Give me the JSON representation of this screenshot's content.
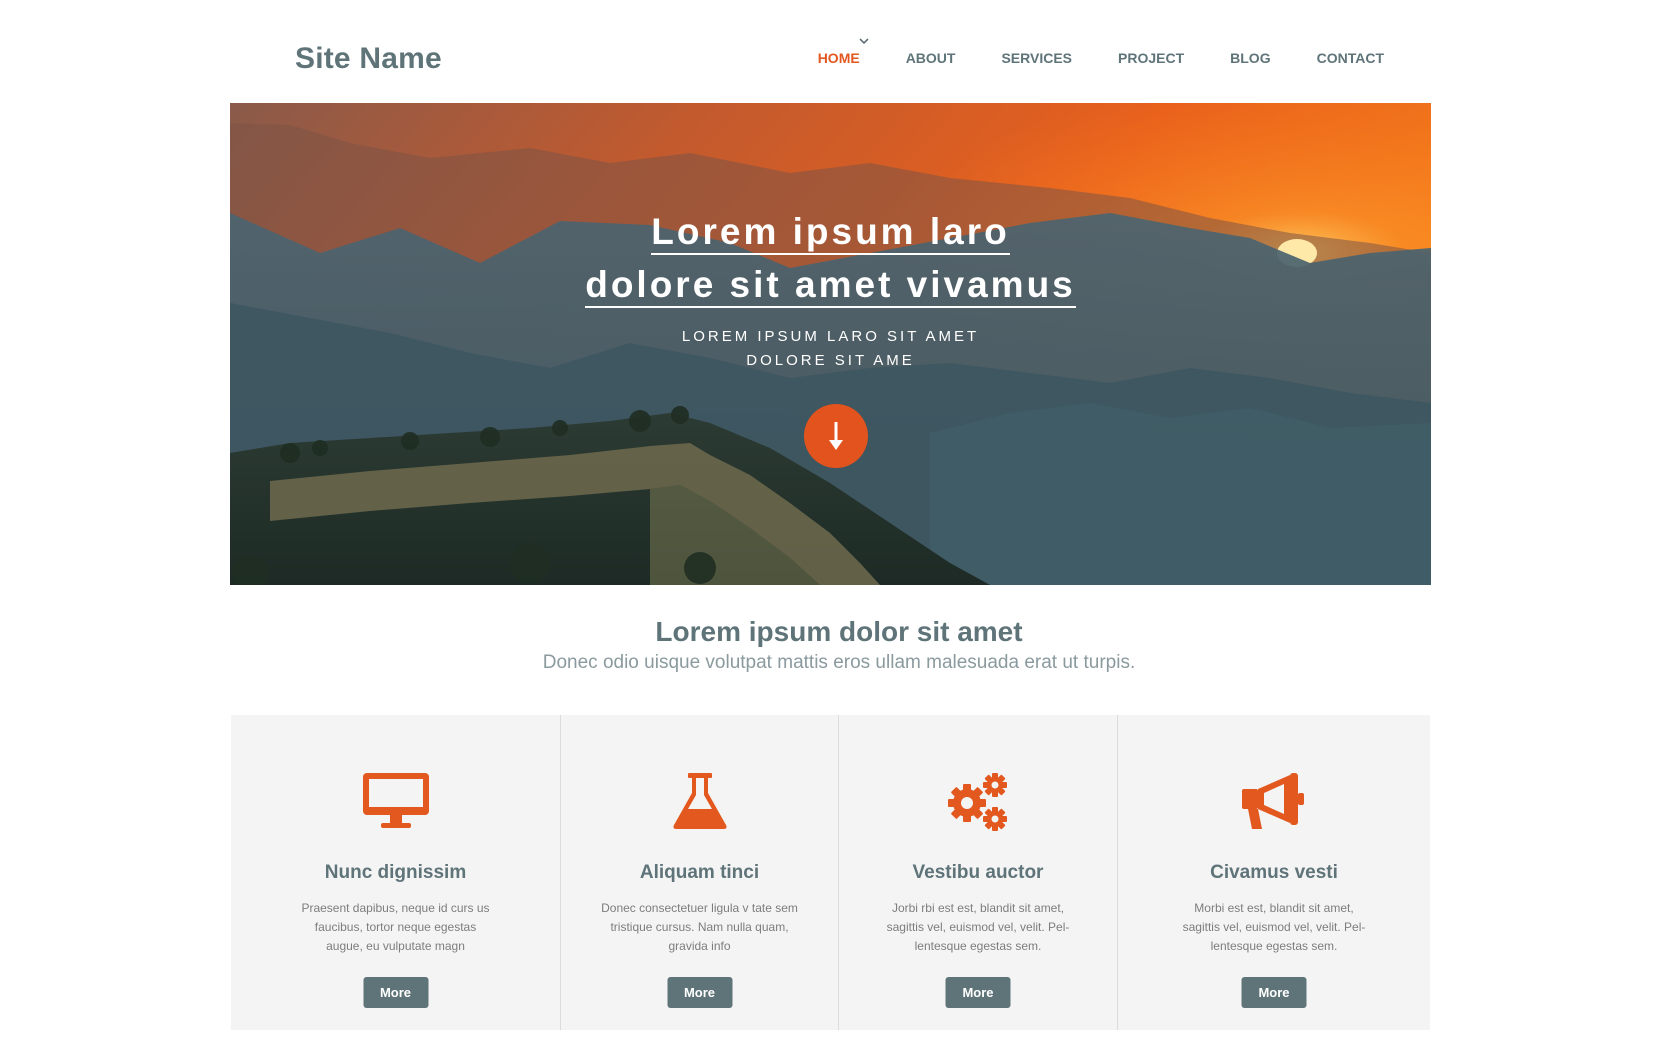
{
  "header": {
    "site_name": "Site Name",
    "nav": [
      "HOME",
      "ABOUT",
      "SERVICES",
      "PROJECT",
      "BLOG",
      "CONTACT"
    ],
    "active_nav": "HOME"
  },
  "hero": {
    "title_line1": "Lorem ipsum laro",
    "title_line2": "dolore sit amet vivamus",
    "subtitle_line1": "LOREM IPSUM LARO SIT AMET",
    "subtitle_line2": "DOLORE SIT AME",
    "button_icon": "arrow-down-icon"
  },
  "intro": {
    "title": "Lorem ipsum dolor sit amet",
    "text": "Donec odio uisque volutpat mattis eros ullam malesuada erat ut turpis."
  },
  "features": [
    {
      "icon": "monitor-icon",
      "title": "Nunc dignissim",
      "text": "Praesent dapibus, neque id curs us faucibus, tortor neque egestas augue, eu vulputate magn",
      "button": "More"
    },
    {
      "icon": "flask-icon",
      "title": "Aliquam tinci",
      "text": "Donec consectetuer ligula v tate sem tristique cursus. Nam nulla quam, gravida info",
      "button": "More"
    },
    {
      "icon": "gears-icon",
      "title": "Vestibu auctor",
      "text": "Jorbi rbi est est, blandit sit amet, sagittis vel, euismod vel, velit. Pel-lentesque egestas sem.",
      "button": "More"
    },
    {
      "icon": "megaphone-icon",
      "title": "Civamus vesti",
      "text": "Morbi est est, blandit sit amet, sagittis vel, euismod vel, velit. Pel-lentesque egestas sem.",
      "button": "More"
    }
  ],
  "colors": {
    "accent": "#e2581f",
    "slate": "#5f7479",
    "panel": "#f4f4f4"
  }
}
